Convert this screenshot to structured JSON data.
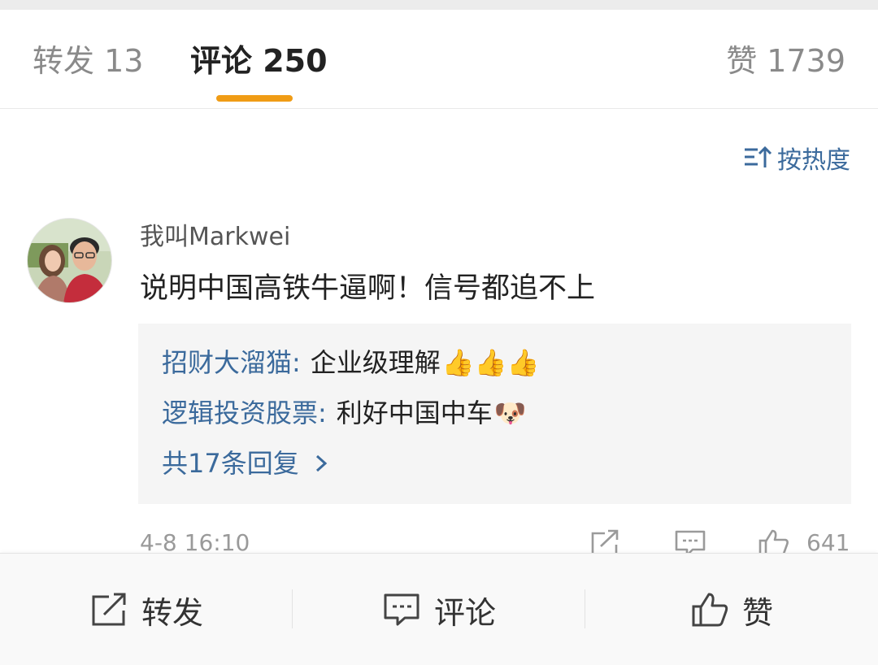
{
  "tabs": {
    "repost": "转发 13",
    "comment": "评论 250",
    "like": "赞 1739"
  },
  "sort": {
    "label": "按热度",
    "icon": "sort-icon"
  },
  "comment": {
    "username": "我叫Markwei",
    "text": "说明中国高铁牛逼啊！信号都追不上",
    "replies": [
      {
        "author": "招财大溜猫",
        "text": "企业级理解",
        "emoji": "👍👍👍"
      },
      {
        "author": "逻辑投资股票",
        "text": "利好中国中车",
        "emoji": "🐶"
      }
    ],
    "more_replies": "共17条回复",
    "timestamp": "4-8 16:10",
    "like_count": "641"
  },
  "bottom_bar": {
    "repost": "转发",
    "comment": "评论",
    "like": "赞"
  },
  "colors": {
    "accent": "#f09c15",
    "link": "#3b6a9c"
  }
}
